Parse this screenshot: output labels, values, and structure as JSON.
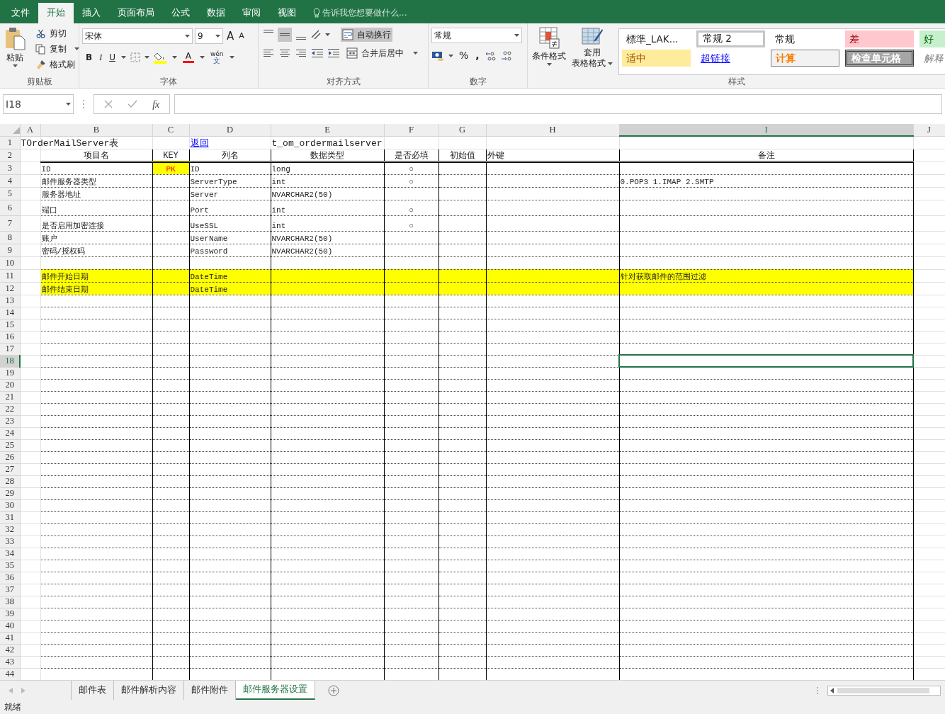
{
  "ribbon": {
    "tabs": [
      {
        "label": "文件",
        "selected": false
      },
      {
        "label": "开始",
        "selected": true
      },
      {
        "label": "插入",
        "selected": false
      },
      {
        "label": "页面布局",
        "selected": false
      },
      {
        "label": "公式",
        "selected": false
      },
      {
        "label": "数据",
        "selected": false
      },
      {
        "label": "审阅",
        "selected": false
      },
      {
        "label": "视图",
        "selected": false
      }
    ],
    "tell_me": "告诉我您想要做什么...",
    "clipboard": {
      "paste": "粘贴",
      "cut": "剪切",
      "copy": "复制",
      "format_painter": "格式刷",
      "label": "剪贴板"
    },
    "font": {
      "name": "宋体",
      "size": "9",
      "grow": "A",
      "shrink": "A",
      "bold": "B",
      "italic": "I",
      "underline": "U",
      "font_color": "A",
      "phonetic_top": "wén",
      "phonetic_bottom": "文",
      "label": "字体"
    },
    "alignment": {
      "wrap_text": {
        "label": "自动换行",
        "on": true
      },
      "merge": "合并后居中",
      "label": "对齐方式"
    },
    "number": {
      "format": "常规",
      "percent": "%",
      "comma": ",",
      "label": "数字"
    },
    "styles": {
      "conditional": "条件格式",
      "table_format_top": "套用",
      "table_format_bottom": "表格格式",
      "label": "样式",
      "gallery": [
        {
          "label": "標準_LAK...",
          "kind": "plain"
        },
        {
          "label": "常规 2",
          "kind": "framed"
        },
        {
          "label": "常规",
          "kind": "plain"
        },
        {
          "label": "差",
          "kind": "bad"
        },
        {
          "label": "好",
          "kind": "good"
        },
        {
          "label": "适中",
          "kind": "neutral"
        },
        {
          "label": "超链接",
          "kind": "link"
        },
        {
          "label": "计算",
          "kind": "calc"
        },
        {
          "label": "检查单元格",
          "kind": "check"
        },
        {
          "label": "解释",
          "kind": "note"
        }
      ]
    }
  },
  "formula_bar": {
    "name_box": "I18",
    "function_label": "fx"
  },
  "sheet": {
    "columns": [
      {
        "label": "A",
        "selected": false
      },
      {
        "label": "B",
        "selected": false
      },
      {
        "label": "C",
        "selected": false
      },
      {
        "label": "D",
        "selected": false
      },
      {
        "label": "E",
        "selected": false
      },
      {
        "label": "F",
        "selected": false
      },
      {
        "label": "G",
        "selected": false
      },
      {
        "label": "H",
        "selected": false
      },
      {
        "label": "I",
        "selected": true
      },
      {
        "label": "J",
        "selected": false
      }
    ],
    "rows": [
      {
        "number": "1",
        "selected": false,
        "highlighted": false,
        "cells": {
          "A": {
            "text": "TOrderMailServer表",
            "kind": "title"
          },
          "D": {
            "text": "返回",
            "kind": "link"
          },
          "E": {
            "text": "t_om_ordermailserver",
            "kind": "title"
          }
        }
      },
      {
        "number": "2",
        "selected": false,
        "highlighted": false,
        "cells": {
          "B": {
            "text": "项目名",
            "kind": "header"
          },
          "C": {
            "text": "KEY",
            "kind": "header"
          },
          "D": {
            "text": "列名",
            "kind": "header"
          },
          "E": {
            "text": "数据类型",
            "kind": "header"
          },
          "F": {
            "text": "是否必填",
            "kind": "header"
          },
          "G": {
            "text": "初始值",
            "kind": "header"
          },
          "H": {
            "text": "外键",
            "kind": "text"
          },
          "I": {
            "text": "备注",
            "kind": "header"
          }
        }
      },
      {
        "number": "3",
        "selected": false,
        "highlighted": false,
        "cells": {
          "B": {
            "text": "ID",
            "kind": "text"
          },
          "C": {
            "text": "PK",
            "kind": "key"
          },
          "D": {
            "text": "ID",
            "kind": "text"
          },
          "E": {
            "text": "long",
            "kind": "text"
          },
          "F": {
            "text": "○",
            "kind": "mark"
          }
        }
      },
      {
        "number": "4",
        "selected": false,
        "highlighted": false,
        "cells": {
          "B": {
            "text": "邮件服务器类型",
            "kind": "text"
          },
          "D": {
            "text": "ServerType",
            "kind": "text"
          },
          "E": {
            "text": "int",
            "kind": "text"
          },
          "F": {
            "text": "○",
            "kind": "mark"
          },
          "I": {
            "text": "0.POP3 1.IMAP 2.SMTP",
            "kind": "text"
          }
        }
      },
      {
        "number": "5",
        "selected": false,
        "highlighted": false,
        "cells": {
          "B": {
            "text": "服务器地址",
            "kind": "text"
          },
          "D": {
            "text": "Server",
            "kind": "text"
          },
          "E": {
            "text": "NVARCHAR2(50)",
            "kind": "text"
          }
        }
      },
      {
        "number": "6",
        "selected": false,
        "highlighted": false,
        "cells": {
          "B": {
            "text": "端口",
            "kind": "text"
          },
          "D": {
            "text": "Port",
            "kind": "text"
          },
          "E": {
            "text": "int",
            "kind": "text"
          },
          "F": {
            "text": "○",
            "kind": "mark"
          }
        }
      },
      {
        "number": "7",
        "selected": false,
        "highlighted": false,
        "cells": {
          "B": {
            "text": "是否启用加密连接",
            "kind": "text"
          },
          "D": {
            "text": "UseSSL",
            "kind": "text"
          },
          "E": {
            "text": "int",
            "kind": "text"
          },
          "F": {
            "text": "○",
            "kind": "mark"
          }
        }
      },
      {
        "number": "8",
        "selected": false,
        "highlighted": false,
        "cells": {
          "B": {
            "text": "账户",
            "kind": "text"
          },
          "D": {
            "text": "UserName",
            "kind": "text"
          },
          "E": {
            "text": "NVARCHAR2(50)",
            "kind": "text"
          }
        }
      },
      {
        "number": "9",
        "selected": false,
        "highlighted": false,
        "cells": {
          "B": {
            "text": "密码/授权码",
            "kind": "text"
          },
          "D": {
            "text": "Password",
            "kind": "text"
          },
          "E": {
            "text": "NVARCHAR2(50)",
            "kind": "text"
          }
        }
      },
      {
        "number": "10",
        "selected": false,
        "highlighted": false
      },
      {
        "number": "11",
        "selected": false,
        "highlighted": true,
        "cells": {
          "B": {
            "text": "邮件开始日期",
            "kind": "text"
          },
          "D": {
            "text": "DateTime",
            "kind": "text"
          },
          "I": {
            "text": "针对获取邮件的范围过滤",
            "kind": "text"
          }
        }
      },
      {
        "number": "12",
        "selected": false,
        "highlighted": true,
        "cells": {
          "B": {
            "text": "邮件结束日期",
            "kind": "text"
          },
          "D": {
            "text": "DateTime",
            "kind": "text"
          }
        }
      },
      {
        "number": "13",
        "selected": false,
        "highlighted": false
      },
      {
        "number": "14",
        "selected": false,
        "highlighted": false
      },
      {
        "number": "15",
        "selected": false,
        "highlighted": false
      },
      {
        "number": "16",
        "selected": false,
        "highlighted": false
      },
      {
        "number": "17",
        "selected": false,
        "highlighted": false
      },
      {
        "number": "18",
        "selected": true,
        "highlighted": false
      },
      {
        "number": "19",
        "selected": false,
        "highlighted": false
      },
      {
        "number": "20",
        "selected": false,
        "highlighted": false
      },
      {
        "number": "21",
        "selected": false,
        "highlighted": false
      },
      {
        "number": "22",
        "selected": false,
        "highlighted": false
      },
      {
        "number": "23",
        "selected": false,
        "highlighted": false
      },
      {
        "number": "24",
        "selected": false,
        "highlighted": false
      },
      {
        "number": "25",
        "selected": false,
        "highlighted": false
      },
      {
        "number": "26",
        "selected": false,
        "highlighted": false
      },
      {
        "number": "27",
        "selected": false,
        "highlighted": false
      },
      {
        "number": "28",
        "selected": false,
        "highlighted": false
      },
      {
        "number": "29",
        "selected": false,
        "highlighted": false
      },
      {
        "number": "30",
        "selected": false,
        "highlighted": false
      },
      {
        "number": "31",
        "selected": false,
        "highlighted": false
      },
      {
        "number": "32",
        "selected": false,
        "highlighted": false
      },
      {
        "number": "33",
        "selected": false,
        "highlighted": false
      },
      {
        "number": "34",
        "selected": false,
        "highlighted": false
      },
      {
        "number": "35",
        "selected": false,
        "highlighted": false
      },
      {
        "number": "36",
        "selected": false,
        "highlighted": false
      },
      {
        "number": "37",
        "selected": false,
        "highlighted": false
      },
      {
        "number": "38",
        "selected": false,
        "highlighted": false
      },
      {
        "number": "39",
        "selected": false,
        "highlighted": false
      },
      {
        "number": "40",
        "selected": false,
        "highlighted": false
      },
      {
        "number": "41",
        "selected": false,
        "highlighted": false
      },
      {
        "number": "42",
        "selected": false,
        "highlighted": false
      },
      {
        "number": "43",
        "selected": false,
        "highlighted": false
      },
      {
        "number": "44",
        "selected": false,
        "highlighted": false
      }
    ]
  },
  "sheet_tabs": [
    {
      "label": "邮件表",
      "selected": false
    },
    {
      "label": "邮件解析内容",
      "selected": false
    },
    {
      "label": "邮件附件",
      "selected": false
    },
    {
      "label": "邮件服务器设置",
      "selected": true
    }
  ],
  "status_bar": {
    "text": "就绪"
  }
}
